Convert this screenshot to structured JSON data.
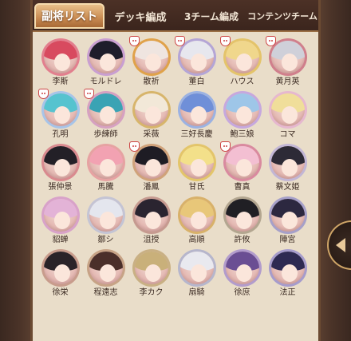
{
  "tabs": [
    {
      "label": "副将リスト",
      "active": true
    },
    {
      "label": "デッキ編成",
      "active": false
    },
    {
      "label": "3チーム編成",
      "active": false
    },
    {
      "label": "コンテンツチーム",
      "active": false
    }
  ],
  "generals": [
    {
      "name": "李斯",
      "ring": "#e27f8e",
      "hair": "#d84a5f",
      "fox": false
    },
    {
      "name": "モルドレ",
      "ring": "#c99fd1",
      "hair": "#1e1d2a",
      "fox": false
    },
    {
      "name": "散祈",
      "ring": "#e0a24a",
      "hair": "#efe5e0",
      "fox": true
    },
    {
      "name": "董白",
      "ring": "#b4a5d6",
      "hair": "#e7e7ee",
      "fox": true
    },
    {
      "name": "ハウス",
      "ring": "#e4c46a",
      "hair": "#f0d78c",
      "fox": true
    },
    {
      "name": "黄月英",
      "ring": "#d07f8c",
      "hair": "#cfd0d9",
      "fox": true
    },
    {
      "name": "孔明",
      "ring": "#a7c4e8",
      "hair": "#56c3cf",
      "fox": true
    },
    {
      "name": "歩練師",
      "ring": "#d6a1c1",
      "hair": "#3aa3b4",
      "fox": true
    },
    {
      "name": "采薇",
      "ring": "#d7b56b",
      "hair": "#f2e8d8",
      "fox": false
    },
    {
      "name": "三好長慶",
      "ring": "#9bb2e2",
      "hair": "#6f8fd8",
      "fox": false
    },
    {
      "name": "鮑三娘",
      "ring": "#c6a8de",
      "hair": "#9ec6e8",
      "fox": false
    },
    {
      "name": "コマ",
      "ring": "#e6b8cf",
      "hair": "#f0de9a",
      "fox": false
    },
    {
      "name": "張仲景",
      "ring": "#d98a8f",
      "hair": "#232027",
      "fox": false
    },
    {
      "name": "馬騰",
      "ring": "#e6a2a2",
      "hair": "#f2a2b2",
      "fox": false
    },
    {
      "name": "潘鳳",
      "ring": "#d0a27a",
      "hair": "#1e1c24",
      "fox": true
    },
    {
      "name": "甘氏",
      "ring": "#e3c56a",
      "hair": "#f3e08a",
      "fox": false
    },
    {
      "name": "曹真",
      "ring": "#d98a9f",
      "hair": "#f3bfd2",
      "fox": true
    },
    {
      "name": "蔡文姫",
      "ring": "#c2b6d5",
      "hair": "#2d2a36",
      "fox": false
    },
    {
      "name": "貂蝉",
      "ring": "#d8a2c9",
      "hair": "#e3b3d7",
      "fox": false
    },
    {
      "name": "鄒シ",
      "ring": "#c4c4d4",
      "hair": "#e4e6ee",
      "fox": false
    },
    {
      "name": "沮授",
      "ring": "#c69a90",
      "hair": "#2a2430",
      "fox": false
    },
    {
      "name": "高順",
      "ring": "#d8b16a",
      "hair": "#e8c779",
      "fox": false
    },
    {
      "name": "許攸",
      "ring": "#b3a690",
      "hair": "#201f24",
      "fox": false
    },
    {
      "name": "陣宮",
      "ring": "#a6a0c9",
      "hair": "#2c2840",
      "fox": false
    },
    {
      "name": "徐栄",
      "ring": "#c89c8c",
      "hair": "#2a2328",
      "fox": false
    },
    {
      "name": "程遠志",
      "ring": "#c7a386",
      "hair": "#4b2f2a",
      "fox": false
    },
    {
      "name": "李カク",
      "ring": "#c9b084",
      "hair": "#c9b07a",
      "fox": false
    },
    {
      "name": "扇騎",
      "ring": "#b6b6cc",
      "hair": "#e9e9ef",
      "fox": false
    },
    {
      "name": "徐庶",
      "ring": "#b29ccc",
      "hair": "#6a4e93",
      "fox": false
    },
    {
      "name": "法正",
      "ring": "#a69ccc",
      "hair": "#2e2a52",
      "fox": false
    }
  ],
  "colors": {
    "active_tab": "#c98b52",
    "panel_bg": "#e9ddc9",
    "frame": "#6b4a32"
  },
  "icons": {
    "next_page": "chevron-left-icon",
    "badge": "fox-mask-icon"
  }
}
